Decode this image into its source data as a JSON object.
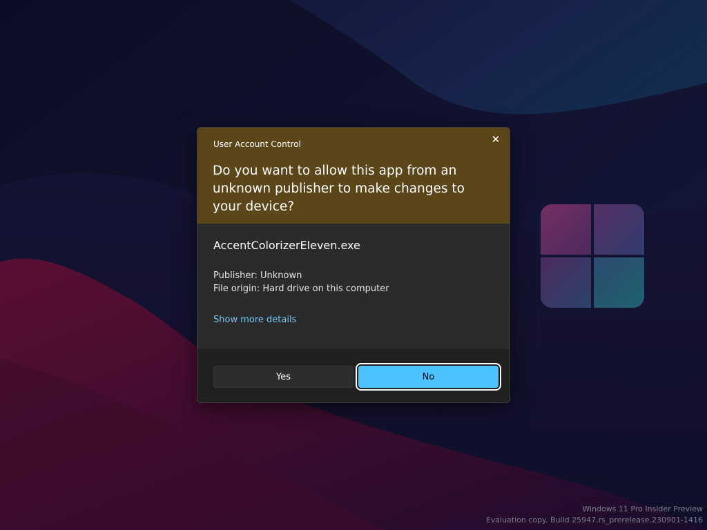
{
  "dialog": {
    "title": "User Account Control",
    "question": "Do you want to allow this app from an unknown publisher to make changes to your device?",
    "app_name": "AccentColorizerEleven.exe",
    "publisher": "Publisher: Unknown",
    "file_origin": "File origin: Hard drive on this computer",
    "details_link": "Show more details",
    "yes_label": "Yes",
    "no_label": "No",
    "close_icon": "close-icon",
    "header_color": "#5a4619",
    "accent_color": "#4cc2ff"
  },
  "desktop": {
    "logo_icon": "windows-logo-icon",
    "watermark_line1": "Windows 11 Pro Insider Preview",
    "watermark_line2": "Evaluation copy. Build 25947.rs_prerelease.230901-1416"
  }
}
